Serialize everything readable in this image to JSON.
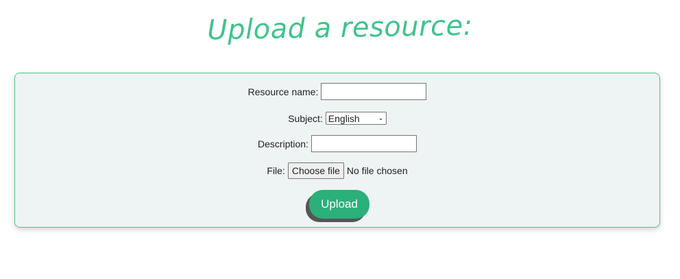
{
  "header": {
    "title": "Upload a resource:"
  },
  "form": {
    "resource_name_label": "Resource name:",
    "resource_name_value": "",
    "subject_label": "Subject:",
    "subject_selected": "English",
    "description_label": "Description:",
    "description_value": "",
    "file_label": "File:",
    "file_button_label": "Choose file",
    "file_status": "No file chosen",
    "submit_label": "Upload"
  },
  "colors": {
    "accent": "#3fc38a",
    "button": "#2bb07a",
    "card_background": "#eef3f3",
    "card_border": "#4bc98f"
  }
}
